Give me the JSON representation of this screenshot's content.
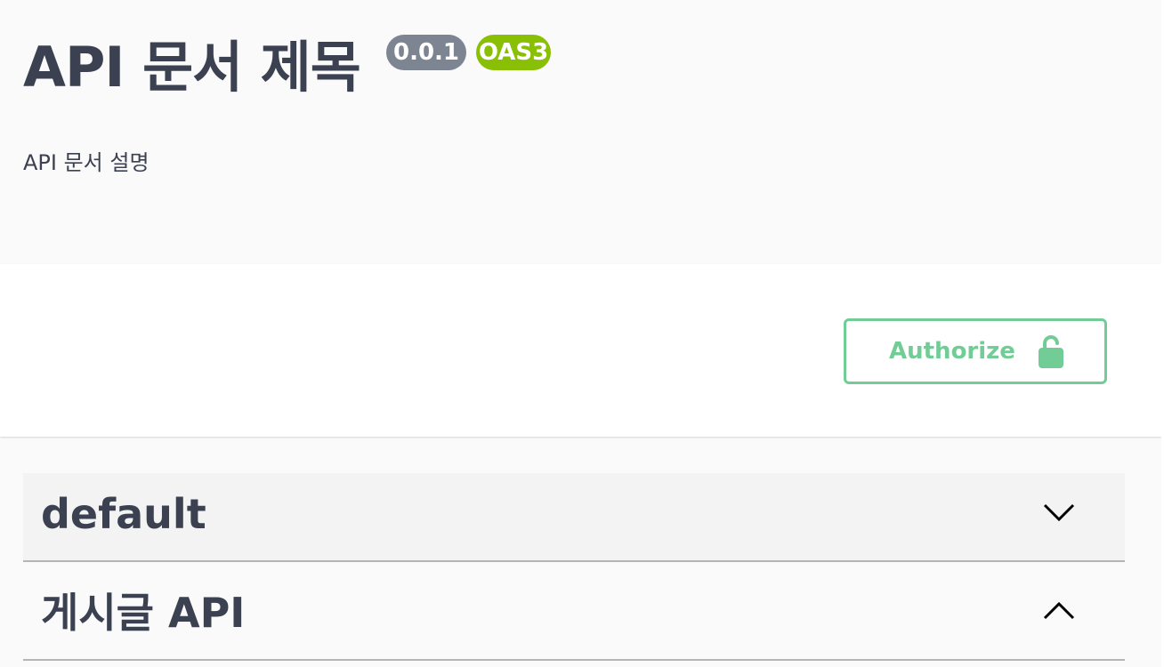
{
  "info": {
    "title": "API 문서 제목",
    "version": "0.0.1",
    "spec": "OAS3",
    "description": "API 문서 설명"
  },
  "scheme": {
    "authorize_label": "Authorize",
    "authorize_icon": "unlocked-lock-icon",
    "accent_color": "#72cc96"
  },
  "tags": [
    {
      "name": "default",
      "icon": "chevron-down-icon",
      "expanded": false
    },
    {
      "name": "게시글 API",
      "icon": "chevron-up-icon",
      "expanded": true
    }
  ],
  "colors": {
    "version_badge": "#7d8492",
    "oas_badge": "#89bf04",
    "text": "#3b4151"
  }
}
